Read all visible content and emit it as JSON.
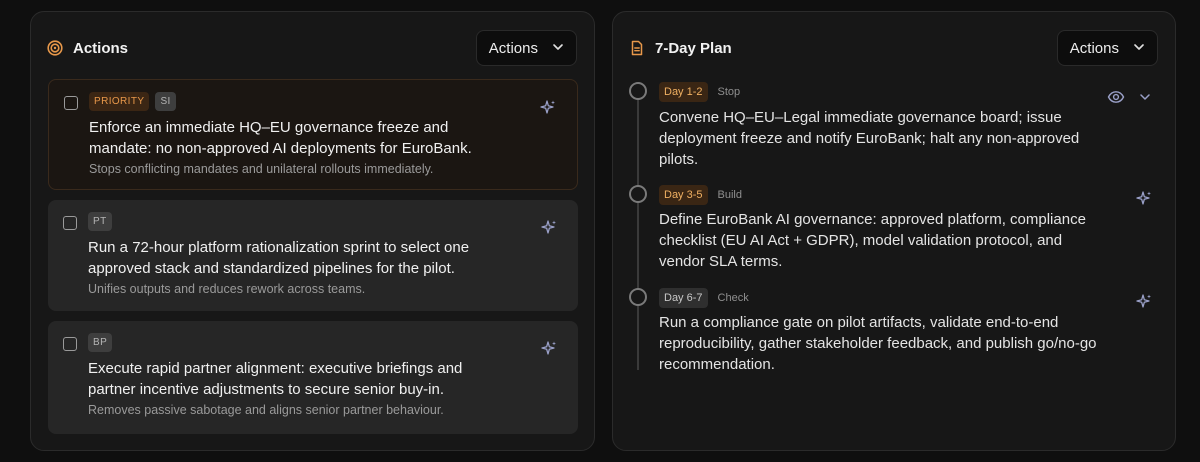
{
  "actions_panel": {
    "title": "Actions",
    "actions_button": "Actions",
    "items": [
      {
        "priority_badge": "PRIORITY",
        "tag": "SI",
        "title": "Enforce an immediate HQ–EU governance freeze and mandate: no non-approved AI deployments for EuroBank.",
        "description": "Stops conflicting mandates and unilateral rollouts immediately."
      },
      {
        "tag": "PT",
        "title": "Run a 72-hour platform rationalization sprint to select one approved stack and standardized pipelines for the pilot.",
        "description": "Unifies outputs and reduces rework across teams."
      },
      {
        "tag": "BP",
        "title": "Execute rapid partner alignment: executive briefings and partner incentive adjustments to secure senior buy-in.",
        "description": "Removes passive sabotage and aligns senior partner behaviour."
      }
    ]
  },
  "plan_panel": {
    "title": "7-Day Plan",
    "actions_button": "Actions",
    "steps": [
      {
        "day": "Day 1-2",
        "kind": "Stop",
        "text": "Convene HQ–EU–Legal immediate governance board; issue deployment freeze and notify EuroBank; halt any non-approved pilots."
      },
      {
        "day": "Day 3-5",
        "kind": "Build",
        "text": "Define EuroBank AI governance: approved platform, compliance checklist (EU AI Act + GDPR), model validation protocol, and vendor SLA terms."
      },
      {
        "day": "Day 6-7",
        "kind": "Check",
        "text": "Run a compliance gate on pilot artifacts, validate end-to-end reproducibility, gather stakeholder feedback, and publish go/no-go recommendation."
      }
    ]
  },
  "colors": {
    "accent_orange": "#e8984a",
    "panel_bg": "#171717",
    "card_bg": "#262626"
  }
}
